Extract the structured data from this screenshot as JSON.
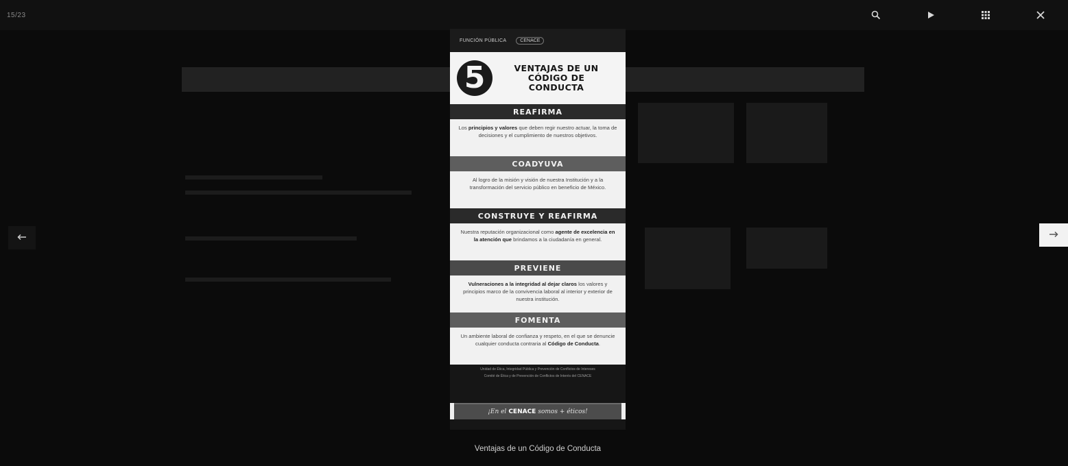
{
  "viewer": {
    "counter": "15/23",
    "caption": "Ventajas de un Código de Conducta",
    "toolbar": [
      {
        "name": "zoom-button",
        "icon": "search-icon"
      },
      {
        "name": "slideshow-button",
        "icon": "play-icon"
      },
      {
        "name": "thumbnails-button",
        "icon": "grid-icon"
      },
      {
        "name": "close-button",
        "icon": "close-icon"
      }
    ],
    "prev_icon": "arrow-left-icon",
    "next_icon": "arrow-right-icon"
  },
  "infographic": {
    "org_left": "FUNCIÓN PÚBLICA",
    "org_right": "CENACE",
    "number": "5",
    "title_line1": "VENTAJAS DE UN",
    "title_line2": "CÓDIGO DE",
    "title_line3": "CONDUCTA",
    "sections": [
      {
        "heading": "REAFIRMA",
        "strong": "principios y valores",
        "text_before": "Los ",
        "text_after": " que deben regir nuestro actuar, la toma de decisiones y el cumplimiento de nuestros objetivos."
      },
      {
        "heading": "COADYUVA",
        "strong": "",
        "text_before": "Al logro de la misión y visión de nuestra Institución y a la transformación del servicio público en beneficio de México.",
        "text_after": ""
      },
      {
        "heading": "CONSTRUYE Y REAFIRMA",
        "strong": "agente de excelencia en la atención que",
        "text_before": "Nuestra reputación organizacional como ",
        "text_after": " brindamos a la ciudadanía en general."
      },
      {
        "heading": "PREVIENE",
        "strong": "Vulneraciones a la integridad al dejar claros",
        "text_before": "",
        "text_after": " los valores y principios marco de la convivencia laboral al interior y exterior de nuestra institución."
      },
      {
        "heading": "FOMENTA",
        "strong": "Código de Conducta",
        "text_before": "Un ambiente laboral de confianza y respeto, en el que se denuncie cualquier conducta contraria al ",
        "text_after": "."
      }
    ],
    "footer_line1": "Unidad de Ética, Integridad Pública y Prevención de Conflictos de Intereses",
    "footer_line2": "Comité de Ética y de Prevención de Conflictos de Interés del CENACE",
    "slogan_before": "¡En el",
    "slogan_bold": "CENACE",
    "slogan_after": "somos + éticos!"
  },
  "colors": {
    "backdrop": "#0b0b0b",
    "band_dark": "#2a2a2a",
    "band_mid": "#5e5e5e"
  }
}
